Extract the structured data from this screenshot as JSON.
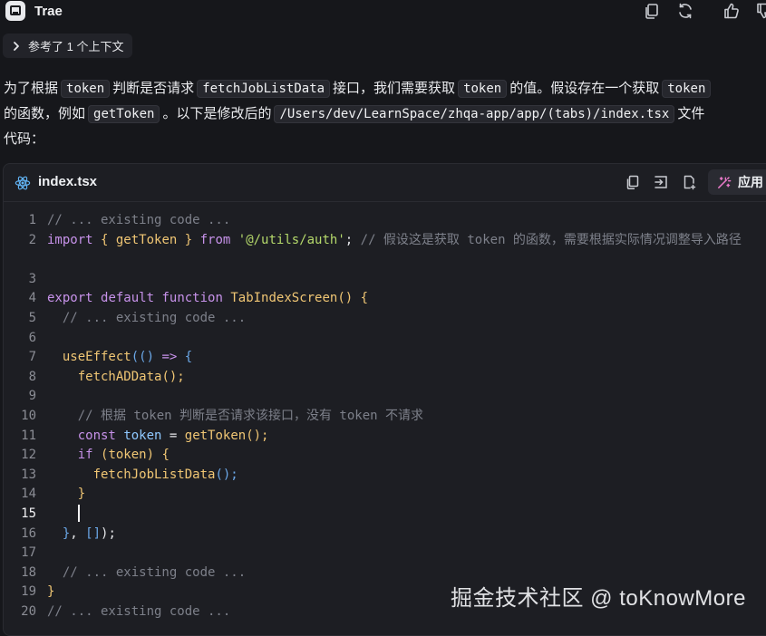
{
  "app": {
    "title": "Trae",
    "icon": "trae-logo-icon"
  },
  "header_actions": [
    {
      "name": "copy-icon"
    },
    {
      "name": "refresh-icon"
    },
    {
      "name": "thumbs-up-icon"
    },
    {
      "name": "thumbs-down-icon"
    }
  ],
  "context_chip": {
    "label": "参考了 1 个上下文",
    "icon": "chevron-right-icon"
  },
  "message": {
    "line1": {
      "t1": "为了根据",
      "c1": "token",
      "t2": "判断是否请求",
      "c2": "fetchJobListData",
      "t3": "接口，我们需要获取",
      "c3": "token",
      "t4": "的值。假设存在一个获取",
      "c4": "token"
    },
    "line2": {
      "t1": "的函数，例如",
      "c1": "getToken",
      "t2": "。以下是修改后的",
      "c2": "/Users/dev/LearnSpace/zhqa-app/app/(tabs)/index.tsx",
      "t3": "文件"
    },
    "line3": {
      "t1": "代码："
    }
  },
  "code_panel": {
    "file_name": "index.tsx",
    "file_icon": "react-icon",
    "actions": [
      {
        "name": "copy-icon"
      },
      {
        "name": "insert-icon"
      },
      {
        "name": "new-file-icon"
      }
    ],
    "apply_label": "应用",
    "lines": [
      {
        "n": "1",
        "tokens": [
          {
            "t": "// ... existing code ...",
            "c": "c"
          }
        ]
      },
      {
        "n": "2",
        "tokens": [
          {
            "t": "import",
            "c": "k"
          },
          {
            "t": " { ",
            "c": "f"
          },
          {
            "t": "getToken",
            "c": "f"
          },
          {
            "t": " } ",
            "c": "f"
          },
          {
            "t": "from",
            "c": "k"
          },
          {
            "t": " ",
            "c": "p"
          },
          {
            "t": "'@/utils/auth'",
            "c": "s"
          },
          {
            "t": "; ",
            "c": "p"
          },
          {
            "t": "// 假设这是获取 token 的函数，需要根据实际情况调整导入路径",
            "c": "c"
          }
        ]
      },
      {
        "n": "3",
        "tokens": []
      },
      {
        "n": "4",
        "tokens": [
          {
            "t": "export",
            "c": "k"
          },
          {
            "t": " ",
            "c": "p"
          },
          {
            "t": "default",
            "c": "k"
          },
          {
            "t": " ",
            "c": "p"
          },
          {
            "t": "function",
            "c": "k"
          },
          {
            "t": " ",
            "c": "p"
          },
          {
            "t": "TabIndexScreen",
            "c": "f"
          },
          {
            "t": "() {",
            "c": "f"
          }
        ]
      },
      {
        "n": "5",
        "tokens": [
          {
            "t": "  // ... existing code ...",
            "c": "c"
          }
        ]
      },
      {
        "n": "6",
        "tokens": []
      },
      {
        "n": "7",
        "tokens": [
          {
            "t": "  ",
            "c": "p"
          },
          {
            "t": "useEffect",
            "c": "f"
          },
          {
            "t": "(() ",
            "c": "b"
          },
          {
            "t": "=>",
            "c": "k"
          },
          {
            "t": " {",
            "c": "b"
          }
        ]
      },
      {
        "n": "8",
        "tokens": [
          {
            "t": "    ",
            "c": "p"
          },
          {
            "t": "fetchADData",
            "c": "f"
          },
          {
            "t": "();",
            "c": "f"
          }
        ]
      },
      {
        "n": "9",
        "tokens": []
      },
      {
        "n": "10",
        "tokens": [
          {
            "t": "    // 根据 token 判断是否请求该接口，没有 token 不请求",
            "c": "c"
          }
        ]
      },
      {
        "n": "11",
        "tokens": [
          {
            "t": "    ",
            "c": "p"
          },
          {
            "t": "const",
            "c": "k"
          },
          {
            "t": " ",
            "c": "p"
          },
          {
            "t": "token",
            "c": "v"
          },
          {
            "t": " = ",
            "c": "p"
          },
          {
            "t": "getToken",
            "c": "f"
          },
          {
            "t": "();",
            "c": "f"
          }
        ]
      },
      {
        "n": "12",
        "tokens": [
          {
            "t": "    ",
            "c": "p"
          },
          {
            "t": "if",
            "c": "k"
          },
          {
            "t": " (",
            "c": "f"
          },
          {
            "t": "token",
            "c": "f"
          },
          {
            "t": ") {",
            "c": "f"
          }
        ]
      },
      {
        "n": "13",
        "tokens": [
          {
            "t": "      ",
            "c": "p"
          },
          {
            "t": "fetchJobListData",
            "c": "f"
          },
          {
            "t": "();",
            "c": "b"
          }
        ]
      },
      {
        "n": "14",
        "tokens": [
          {
            "t": "    }",
            "c": "f"
          }
        ]
      },
      {
        "n": "15",
        "tokens": [],
        "caret": true
      },
      {
        "n": "16",
        "tokens": [
          {
            "t": "  }",
            "c": "b"
          },
          {
            "t": ", ",
            "c": "p"
          },
          {
            "t": "[]",
            "c": "b"
          },
          {
            "t": ");",
            "c": "p"
          }
        ]
      },
      {
        "n": "17",
        "tokens": []
      },
      {
        "n": "18",
        "tokens": [
          {
            "t": "  // ... existing code ...",
            "c": "c"
          }
        ]
      },
      {
        "n": "19",
        "tokens": [
          {
            "t": "}",
            "c": "f"
          }
        ]
      },
      {
        "n": "20",
        "tokens": [
          {
            "t": "// ... existing code ...",
            "c": "c"
          }
        ]
      }
    ]
  },
  "watermark": "掘金技术社区 @ toKnowMore"
}
